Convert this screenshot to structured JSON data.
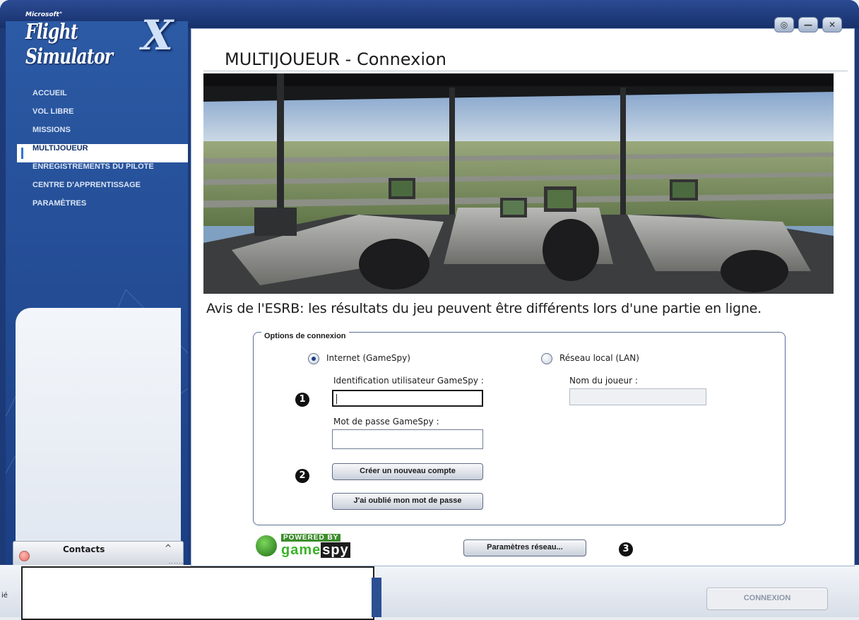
{
  "app": {
    "brand_small": "Microsoft°",
    "brand_name": "Flight Simulator",
    "brand_x": "X"
  },
  "window_controls": {
    "sound_icon": "speaker-muted-icon",
    "minimize_icon": "minimize-icon",
    "close_icon": "close-icon"
  },
  "sidebar": {
    "items": [
      {
        "label": "ACCUEIL"
      },
      {
        "label": "VOL LIBRE"
      },
      {
        "label": "MISSIONS"
      },
      {
        "label": "MULTIJOUEUR",
        "active": true
      },
      {
        "label": "ENREGISTREMENTS DU PILOTE"
      },
      {
        "label": "CENTRE D'APPRENTISSAGE"
      },
      {
        "label": "PARAMÈTRES"
      }
    ]
  },
  "contacts": {
    "label": "Contacts",
    "chevron": "^",
    "grip": "......"
  },
  "chat": {
    "partial_label": "ié"
  },
  "page": {
    "title": "MULTIJOUEUR - Connexion",
    "notice": "Avis de l'ESRB: les résultats du jeu peuvent être différents lors d'une partie en ligne."
  },
  "options": {
    "legend": "Options de connexion",
    "radio_internet": "Internet (GameSpy)",
    "radio_lan": "Réseau local (LAN)",
    "selected": "internet",
    "user_id_label": "Identification utilisateur GameSpy :",
    "user_id_value": "",
    "player_name_label": "Nom du joueur :",
    "player_name_value": "",
    "password_label": "Mot de passe GameSpy :",
    "password_value": "",
    "create_account": "Créer un nouveau compte",
    "forgot_password": "J'ai oublié mon mot de passe"
  },
  "markers": {
    "one": "1",
    "two": "2",
    "three": "3"
  },
  "footer": {
    "gamespy_powered": "POWERED BY",
    "gamespy_a": "game",
    "gamespy_b": "spy",
    "network_settings": "Paramètres réseau...",
    "connect": "CONNEXION"
  }
}
